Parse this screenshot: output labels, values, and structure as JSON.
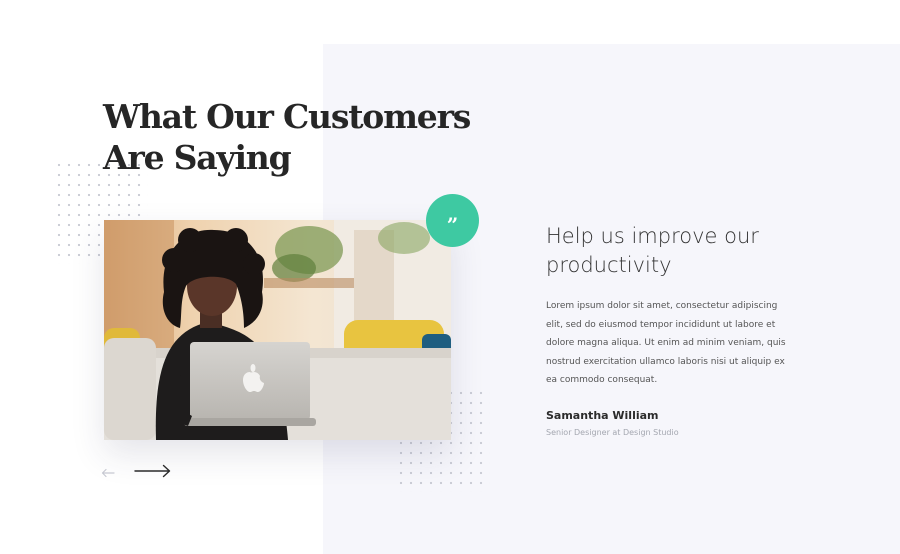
{
  "section": {
    "heading_line1": "What Our Customers",
    "heading_line2": "Are Saying"
  },
  "quote_badge": {
    "glyph": "”",
    "icon": "quote-icon",
    "color": "#3ec9a2"
  },
  "testimonial": {
    "title_line1": "Help us improve our",
    "title_line2": "productivity",
    "body_lines": [
      "Lorem ipsum dolor sit amet, consectetur adipiscing",
      "elit, sed do eiusmod tempor incididunt ut labore et",
      "dolore magna aliqua. Ut enim ad minim veniam, quis",
      "nostrud exercitation ullamco laboris nisi ut aliquip ex",
      "ea commodo consequat."
    ],
    "author_name": "Samantha William",
    "author_role": "Senior Designer at Design Studio"
  },
  "navigation": {
    "prev_icon": "arrow-left-icon",
    "next_icon": "arrow-right-icon"
  },
  "photo": {
    "subject": "woman-with-laptop-photo"
  },
  "colors": {
    "panel_background": "#f6f6fb",
    "accent": "#3ec9a2",
    "heading": "#262626"
  }
}
